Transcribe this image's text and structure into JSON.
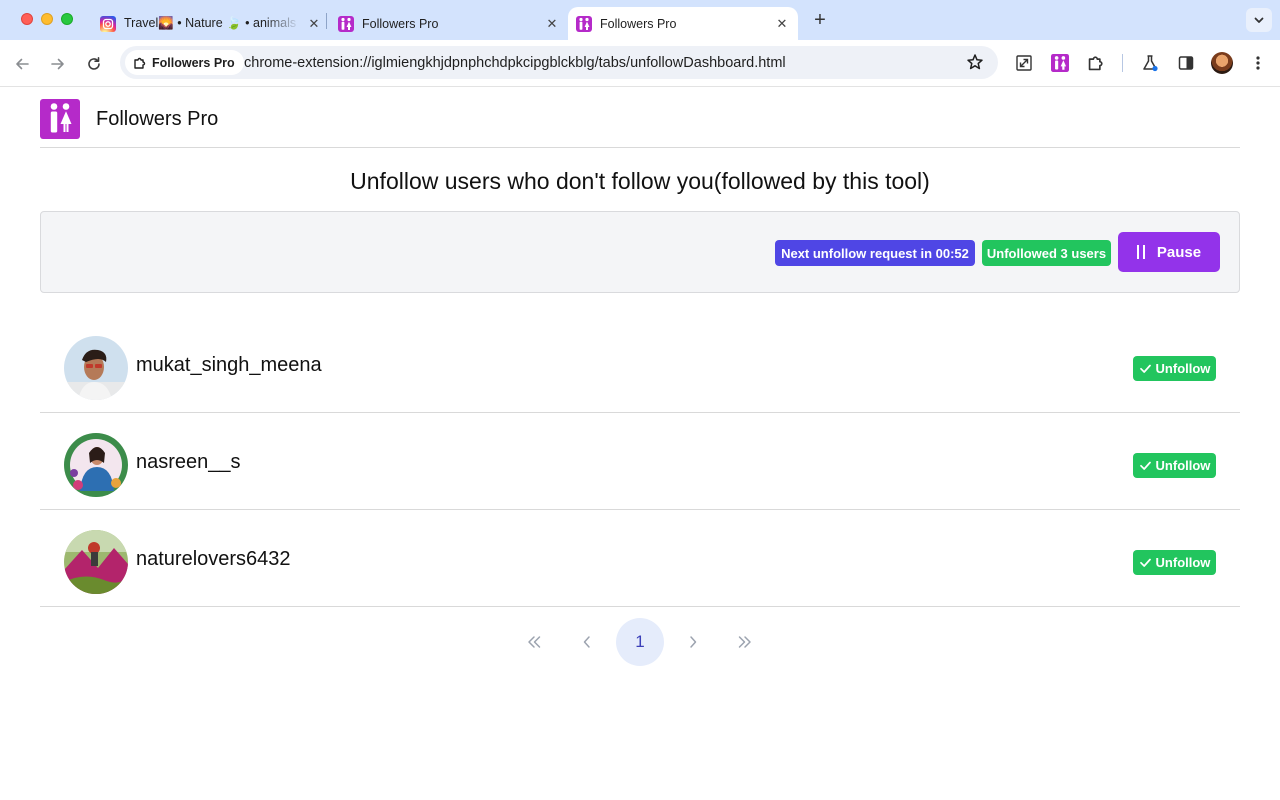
{
  "browser": {
    "tabs": [
      {
        "title": "Travel🌄 • Nature 🍃 • animals",
        "active": false
      },
      {
        "title": "Followers Pro",
        "active": false
      },
      {
        "title": "Followers Pro",
        "active": true
      }
    ],
    "site_chip": "Followers Pro",
    "url": "chrome-extension://iglmiengkhjdpnphchdpkcipgblckblg/tabs/unfollowDashboard.html"
  },
  "header": {
    "brand": "Followers Pro"
  },
  "main": {
    "title": "Unfollow users who don't follow you(followed by this tool)",
    "next_request_badge": "Next unfollow request in 00:52",
    "unfollowed_badge": "Unfollowed 3 users",
    "pause_label": "Pause"
  },
  "users": [
    {
      "username": "mukat_singh_meena",
      "action_label": "Unfollow"
    },
    {
      "username": "nasreen__s",
      "action_label": "Unfollow"
    },
    {
      "username": "naturelovers6432",
      "action_label": "Unfollow"
    }
  ],
  "pagination": {
    "current_page": "1"
  },
  "colors": {
    "brand": "#b52ac9",
    "next_badge": "#4f46e5",
    "success": "#22c55e",
    "pause": "#9333ea"
  }
}
